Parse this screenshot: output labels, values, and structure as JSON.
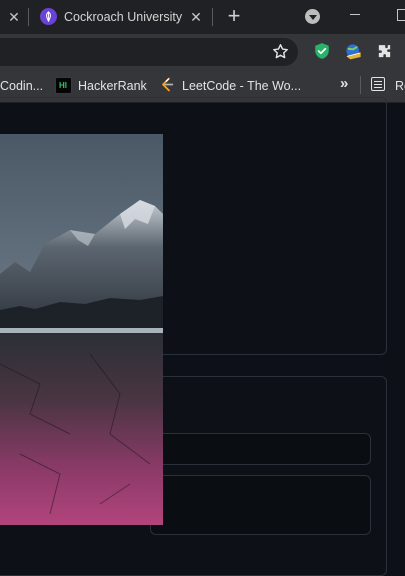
{
  "browser": {
    "active_tab": {
      "title": "Cockroach University |",
      "favicon": "cockroach-logo-icon"
    },
    "controls": {
      "close_glyph": "✕",
      "new_tab_glyph": "+",
      "bookmarks_overflow_glyph": "»"
    },
    "toolbar_icons": [
      "star-icon",
      "shield-check-icon",
      "globe-extension-icon",
      "puzzle-icon"
    ]
  },
  "bookmarks": {
    "items": [
      {
        "label": "Codin...",
        "icon": "none"
      },
      {
        "label": "HackerRank",
        "icon": "hackerrank-icon",
        "icon_text": "HI"
      },
      {
        "label": "LeetCode - The Wo...",
        "icon": "leetcode-icon"
      }
    ],
    "reading_list_label": "Re"
  },
  "colors": {
    "tabstrip": "#202124",
    "toolbar": "#35363a",
    "page_background": "#0d1016",
    "card_border": "#2b313a",
    "accent_purple": "#6a42d7",
    "shield_green": "#27b36a"
  }
}
